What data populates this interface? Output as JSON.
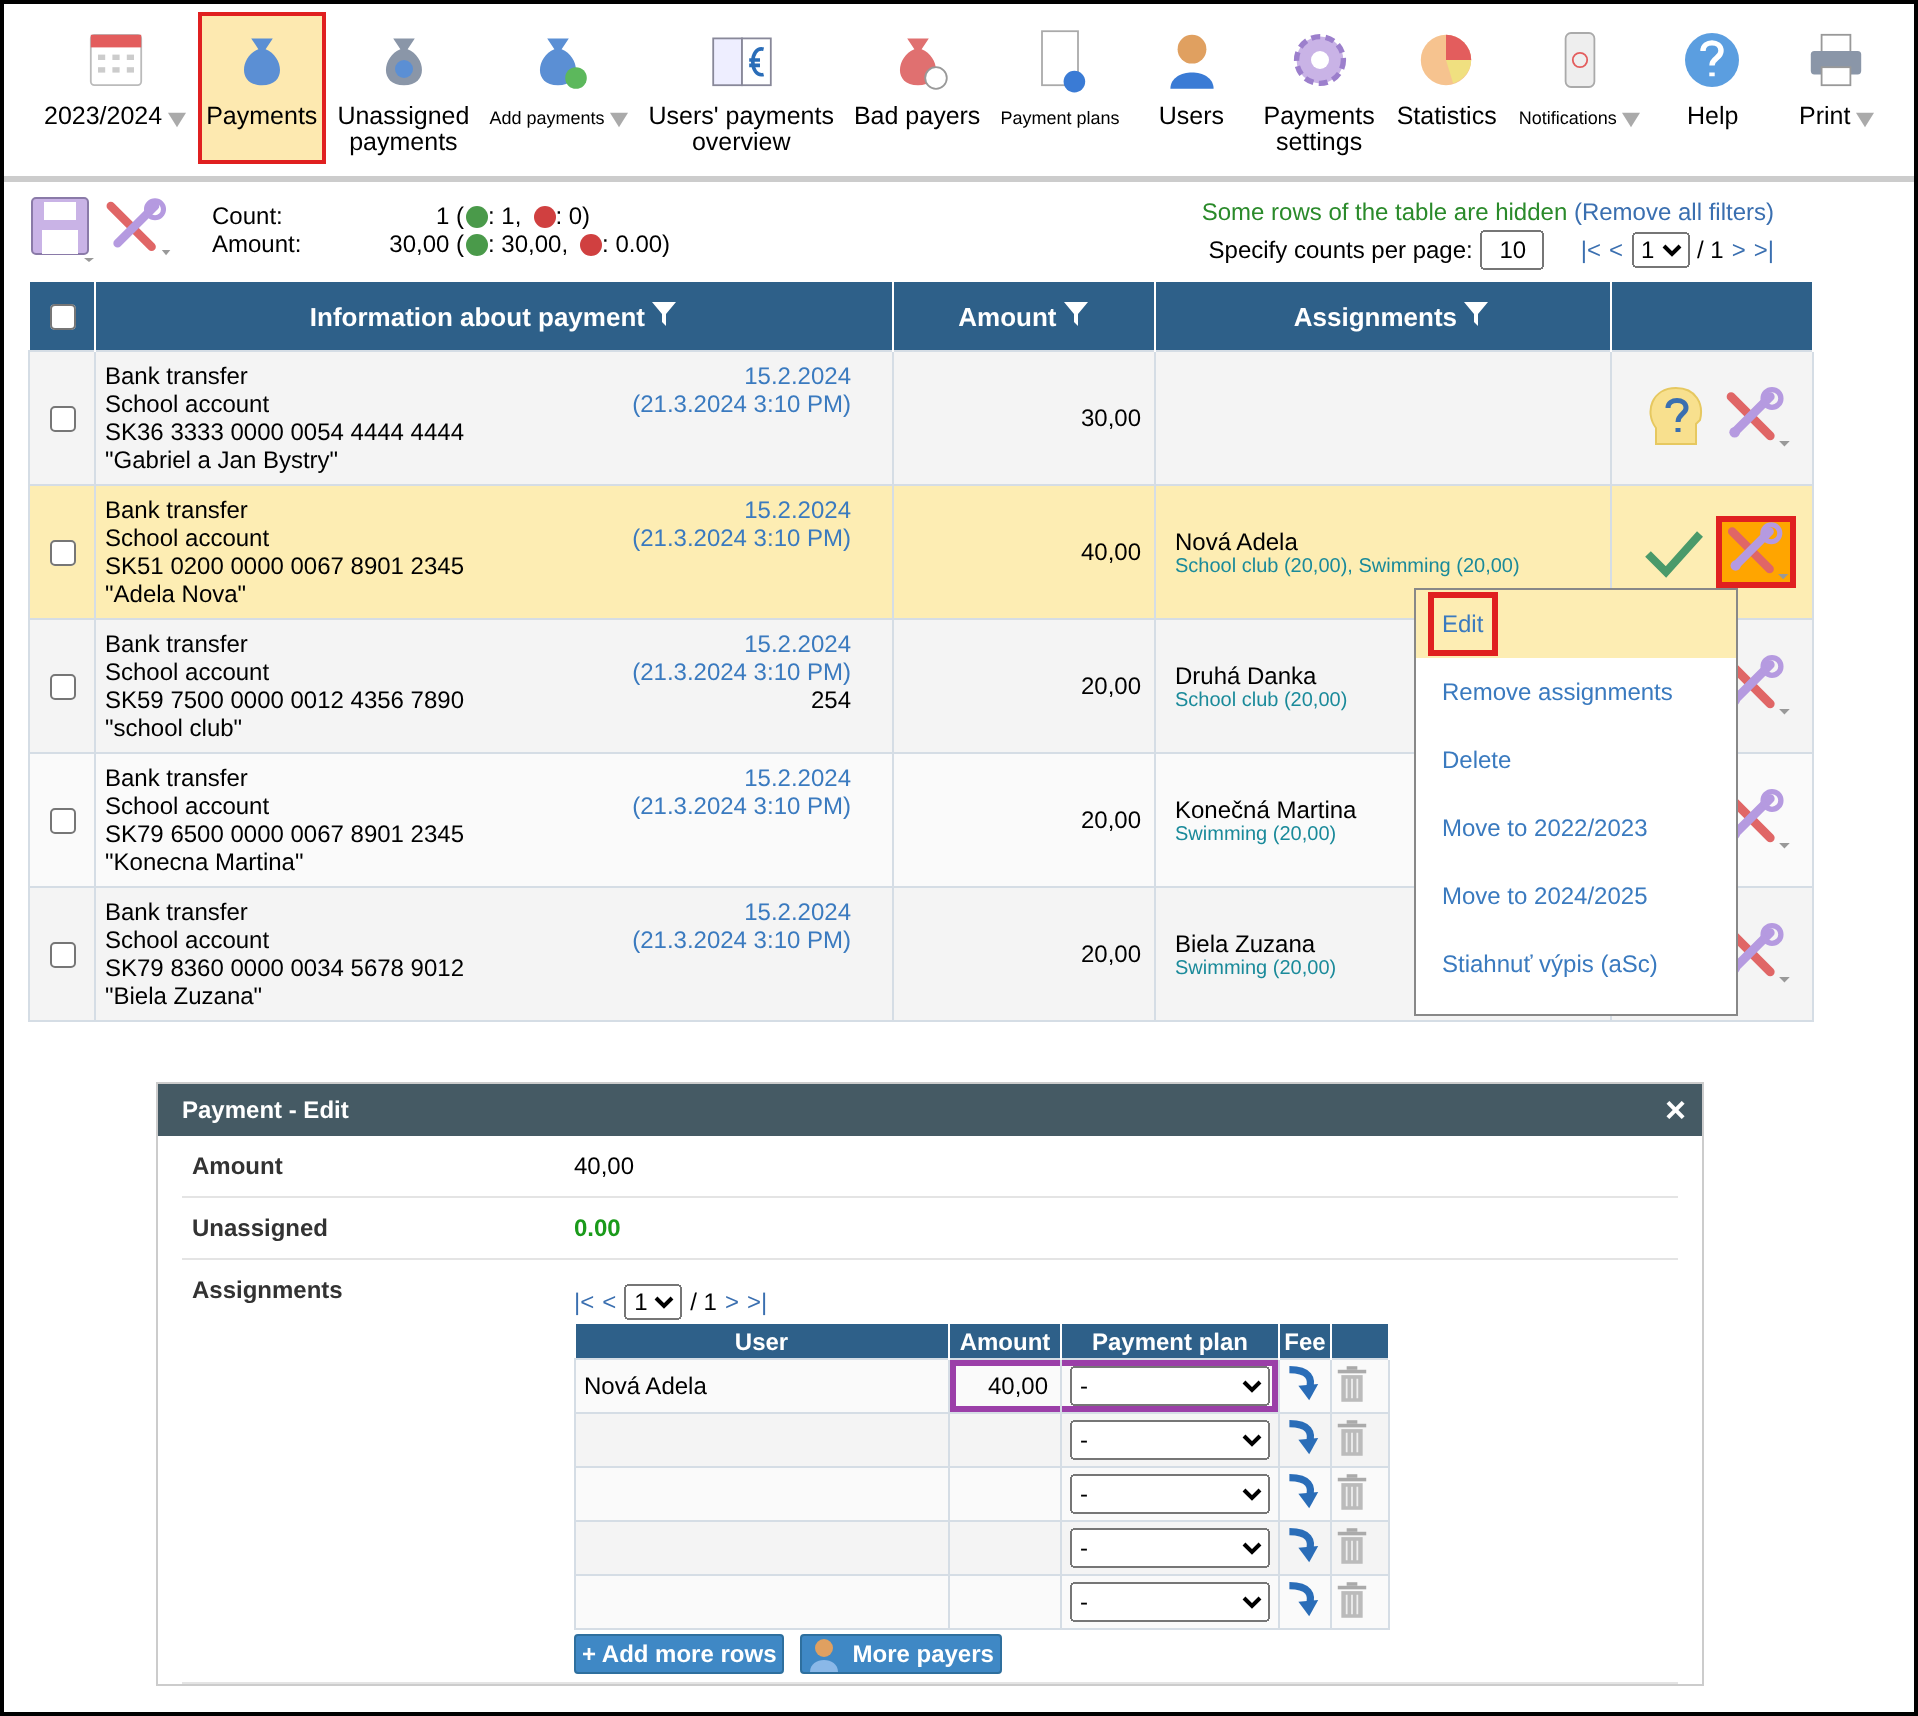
{
  "toolbar": {
    "items": [
      {
        "label": "2023/2024",
        "dropdown": true,
        "small": false,
        "selected": false,
        "annotated": false
      },
      {
        "label": "Payments",
        "dropdown": false,
        "small": false,
        "selected": true,
        "annotated": true
      },
      {
        "label": "Unassigned\npayments",
        "dropdown": false,
        "small": false,
        "selected": false,
        "annotated": false
      },
      {
        "label": "Add payments",
        "dropdown": true,
        "small": true,
        "selected": false,
        "annotated": false
      },
      {
        "label": "Users' payments\noverview",
        "dropdown": false,
        "small": false,
        "selected": false,
        "annotated": false
      },
      {
        "label": "Bad payers",
        "dropdown": false,
        "small": false,
        "selected": false,
        "annotated": false
      },
      {
        "label": "Payment plans",
        "dropdown": false,
        "small": true,
        "selected": false,
        "annotated": false
      },
      {
        "label": "Users",
        "dropdown": false,
        "small": false,
        "selected": false,
        "annotated": false
      },
      {
        "label": "Payments\nsettings",
        "dropdown": false,
        "small": false,
        "selected": false,
        "annotated": false
      },
      {
        "label": "Statistics",
        "dropdown": false,
        "small": false,
        "selected": false,
        "annotated": false
      },
      {
        "label": "Notifications",
        "dropdown": true,
        "small": true,
        "selected": false,
        "annotated": false
      },
      {
        "label": "Help",
        "dropdown": false,
        "small": false,
        "selected": false,
        "annotated": false
      },
      {
        "label": "Print",
        "dropdown": true,
        "small": false,
        "selected": false,
        "annotated": false
      }
    ]
  },
  "summary": {
    "count_label": "Count:",
    "count": "1 (",
    "count_plus": ": 1,",
    "count_minus": ": 0)",
    "amount_label": "Amount:",
    "amount": "30,00 (",
    "amount_plus": ": 30,00,",
    "amount_minus": ": 0.00)"
  },
  "filter_notice": {
    "text": "Some rows of the table are hidden",
    "link": "(Remove all filters)"
  },
  "paging": {
    "label": "Specify counts per page:",
    "per_page": "10",
    "first": "|<",
    "prev": "<",
    "page": "1",
    "total": "/ 1",
    "next": ">",
    "last": ">|"
  },
  "table": {
    "header_checked": false,
    "columns": [
      "Information about payment",
      "Amount",
      "Assignments"
    ],
    "rows": [
      {
        "checked": false,
        "selected": false,
        "method": "Bank transfer",
        "account": "School account",
        "iban": "SK36 3333 0000 0054 4444 4444",
        "note": "\"Gabriel a Jan Bystry\"",
        "date": "15.2.2024",
        "time": "(21.3.2024 3:10 PM)",
        "extra": "",
        "amount": "30,00",
        "assignee": "",
        "details": "",
        "kind": "unknown",
        "tools_annotated": false
      },
      {
        "checked": false,
        "selected": true,
        "method": "Bank transfer",
        "account": "School account",
        "iban": "SK51 0200 0000 0067 8901 2345",
        "note": "\"Adela Nova\"",
        "date": "15.2.2024",
        "time": "(21.3.2024 3:10 PM)",
        "extra": "",
        "amount": "40,00",
        "assignee": "Nová Adela",
        "details": "School club (20,00), Swimming (20,00)",
        "kind": "ok",
        "tools_annotated": true
      },
      {
        "checked": false,
        "selected": false,
        "method": "Bank transfer",
        "account": "School account",
        "iban": "SK59 7500 0000 0012 4356 7890",
        "note": "\"school club\"",
        "date": "15.2.2024",
        "time": "(21.3.2024 3:10 PM)",
        "extra": "254",
        "amount": "20,00",
        "assignee": "Druhá Danka",
        "details": "School club (20,00)",
        "tools_annotated": false
      },
      {
        "checked": false,
        "selected": false,
        "method": "Bank transfer",
        "account": "School account",
        "iban": "SK79 6500 0000 0067 8901 2345",
        "note": "\"Konecna Martina\"",
        "date": "15.2.2024",
        "time": "(21.3.2024 3:10 PM)",
        "extra": "",
        "amount": "20,00",
        "assignee": "Konečná Martina",
        "details": "Swimming (20,00)",
        "tools_annotated": false
      },
      {
        "checked": false,
        "selected": false,
        "method": "Bank transfer",
        "account": "School account",
        "iban": "SK79 8360 0000 0034 5678 9012",
        "note": "\"Biela Zuzana\"",
        "date": "15.2.2024",
        "time": "(21.3.2024 3:10 PM)",
        "extra": "",
        "amount": "20,00",
        "assignee": "Biela Zuzana",
        "details": "Swimming (20,00)",
        "tools_annotated": false
      }
    ]
  },
  "context_menu": {
    "items": [
      {
        "label": "Edit",
        "selected": true,
        "annotated": true
      },
      {
        "label": "Remove assignments",
        "selected": false,
        "annotated": false
      },
      {
        "label": "Delete",
        "selected": false,
        "annotated": false
      },
      {
        "label": "Move to 2022/2023",
        "selected": false,
        "annotated": false
      },
      {
        "label": "Move to 2024/2025",
        "selected": false,
        "annotated": false
      },
      {
        "label": "Stiahnuť výpis (aSc)",
        "selected": false,
        "annotated": false
      }
    ]
  },
  "dialog": {
    "title": "Payment - Edit",
    "close": "×",
    "amount_label": "Amount",
    "amount": "40,00",
    "unassigned_label": "Unassigned",
    "unassigned": "0.00",
    "assignments_label": "Assignments",
    "paging": {
      "first": "|<",
      "prev": "<",
      "page": "1",
      "total": "/ 1",
      "next": ">",
      "last": ">|"
    },
    "columns": [
      "User",
      "Amount",
      "Payment plan",
      "Fee"
    ],
    "rows": [
      {
        "user": "Nová Adela",
        "amount": "40,00",
        "plan": "-",
        "annotated": true
      },
      {
        "user": "",
        "amount": "",
        "plan": "-",
        "annotated": false
      },
      {
        "user": "",
        "amount": "",
        "plan": "-",
        "annotated": false
      },
      {
        "user": "",
        "amount": "",
        "plan": "-",
        "annotated": false
      },
      {
        "user": "",
        "amount": "",
        "plan": "-",
        "annotated": false
      }
    ],
    "add_rows": "+ Add more rows",
    "more_payers": "More payers"
  }
}
